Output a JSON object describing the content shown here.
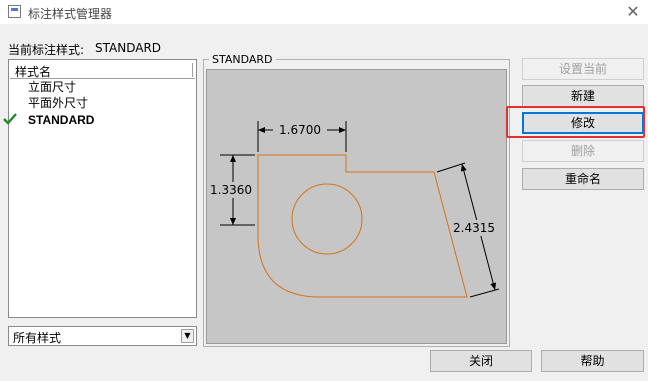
{
  "window": {
    "title": "标注样式管理器",
    "close_symbol": "✕"
  },
  "current_style": {
    "label": "当前标注样式:",
    "value": "STANDARD"
  },
  "styles_list": {
    "header": "样式名",
    "items": [
      {
        "label": "立面尺寸",
        "selected": false
      },
      {
        "label": "平面外尺寸",
        "selected": false
      },
      {
        "label": "STANDARD",
        "selected": true
      }
    ]
  },
  "filter": {
    "value": "所有样式"
  },
  "preview": {
    "group_label": "STANDARD",
    "dims": {
      "top": "1.6700",
      "left": "1.3360",
      "right": "2.4315"
    },
    "colors": {
      "outline": "#d4731a",
      "background": "#c6c6c6"
    }
  },
  "buttons": {
    "set_current": "设置当前",
    "new": "新建",
    "modify": "修改",
    "delete": "删除",
    "rename": "重命名",
    "close": "关闭",
    "help": "帮助"
  },
  "colors": {
    "highlight": "#e53030",
    "focus": "#0078d7"
  }
}
